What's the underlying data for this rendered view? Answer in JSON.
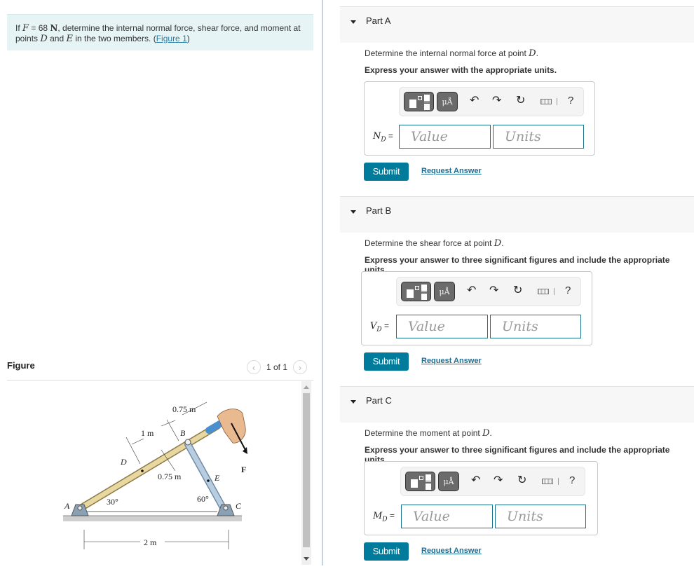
{
  "problem": {
    "prefix": "If ",
    "F_sym": "F",
    "eq": " = 68 ",
    "unit": "N",
    "mid": ", determine the internal normal force, shear force, and moment at points ",
    "D": "D",
    "and": " and ",
    "E": "E",
    "suffix": " in the two members. (",
    "link": "Figure 1",
    "close": ")"
  },
  "figure": {
    "title": "Figure",
    "pager": "1 of 1",
    "prev_icon": "chevron-left-icon",
    "next_icon": "chevron-right-icon",
    "labels": {
      "A": "A",
      "B": "B",
      "C": "C",
      "D": "D",
      "E": "E",
      "F": "F",
      "dim_075_top": "0.75 m",
      "dim_1": "1 m",
      "dim_075_mid": "0.75 m",
      "dim_2": "2 m",
      "angle_30": "30°",
      "angle_60": "60°"
    }
  },
  "parts": [
    {
      "label": "Part A",
      "question": "Determine the internal normal force at point ",
      "point": "D",
      "instruction": "Express your answer with the appropriate units.",
      "var": "N",
      "sub": "D",
      "eq": " =",
      "value_placeholder": "Value",
      "units_placeholder": "Units",
      "submit": "Submit",
      "request": "Request Answer"
    },
    {
      "label": "Part B",
      "question": "Determine the shear force at point ",
      "point": "D",
      "instruction": "Express your answer to three significant figures and include the appropriate units.",
      "var": "V",
      "sub": "D",
      "eq": " =",
      "value_placeholder": "Value",
      "units_placeholder": "Units",
      "submit": "Submit",
      "request": "Request Answer"
    },
    {
      "label": "Part C",
      "question": "Determine the moment at point ",
      "point": "D",
      "instruction": "Express your answer to three significant figures and include the appropriate units.",
      "var": "M",
      "sub": "D",
      "eq": " =",
      "value_placeholder": "Value",
      "units_placeholder": "Units",
      "submit": "Submit",
      "request": "Request Answer"
    }
  ],
  "toolbar": {
    "units_label": "μÅ",
    "undo": "↶",
    "redo": "↷",
    "reset": "↻",
    "help": "?"
  }
}
